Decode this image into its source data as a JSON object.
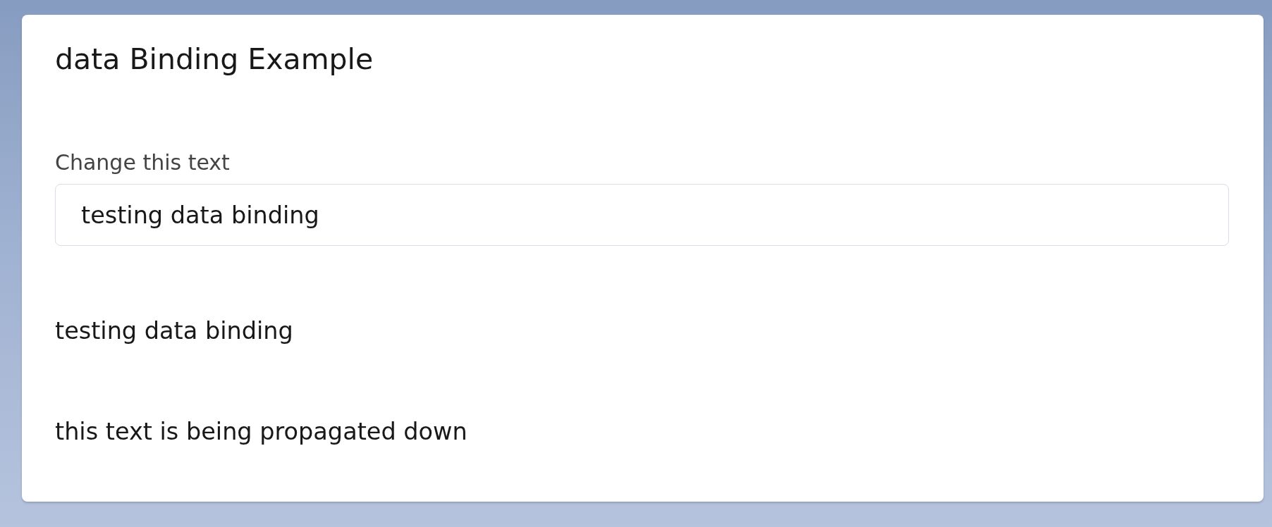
{
  "card": {
    "title": "data Binding Example",
    "field": {
      "label": "Change this text",
      "value": "testing data binding"
    },
    "outputs": [
      "testing data binding",
      "this text is being propagated down"
    ]
  }
}
